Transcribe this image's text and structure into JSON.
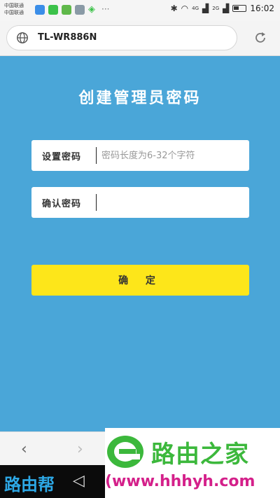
{
  "status_bar": {
    "carrier_line1": "中国联通",
    "carrier_line2": "中国联通",
    "network1": "4G",
    "network2": "2G",
    "time": "16:02"
  },
  "address_bar": {
    "url": "TL-WR886N"
  },
  "page": {
    "title": "创建管理员密码",
    "set_password_label": "设置密码",
    "set_password_placeholder": "密码长度为6-32个字符",
    "set_password_value": "",
    "confirm_password_label": "确认密码",
    "confirm_password_value": "",
    "confirm_button": "确 定"
  },
  "watermark": {
    "brand_text": "路由之家",
    "brand_url": "(www.hhhyh.com",
    "left_text": "路由帮"
  },
  "colors": {
    "panel_bg": "#4aa6d8",
    "button_bg": "#fde61a",
    "brand_green": "#3cb83c",
    "brand_pink": "#d4208a"
  }
}
